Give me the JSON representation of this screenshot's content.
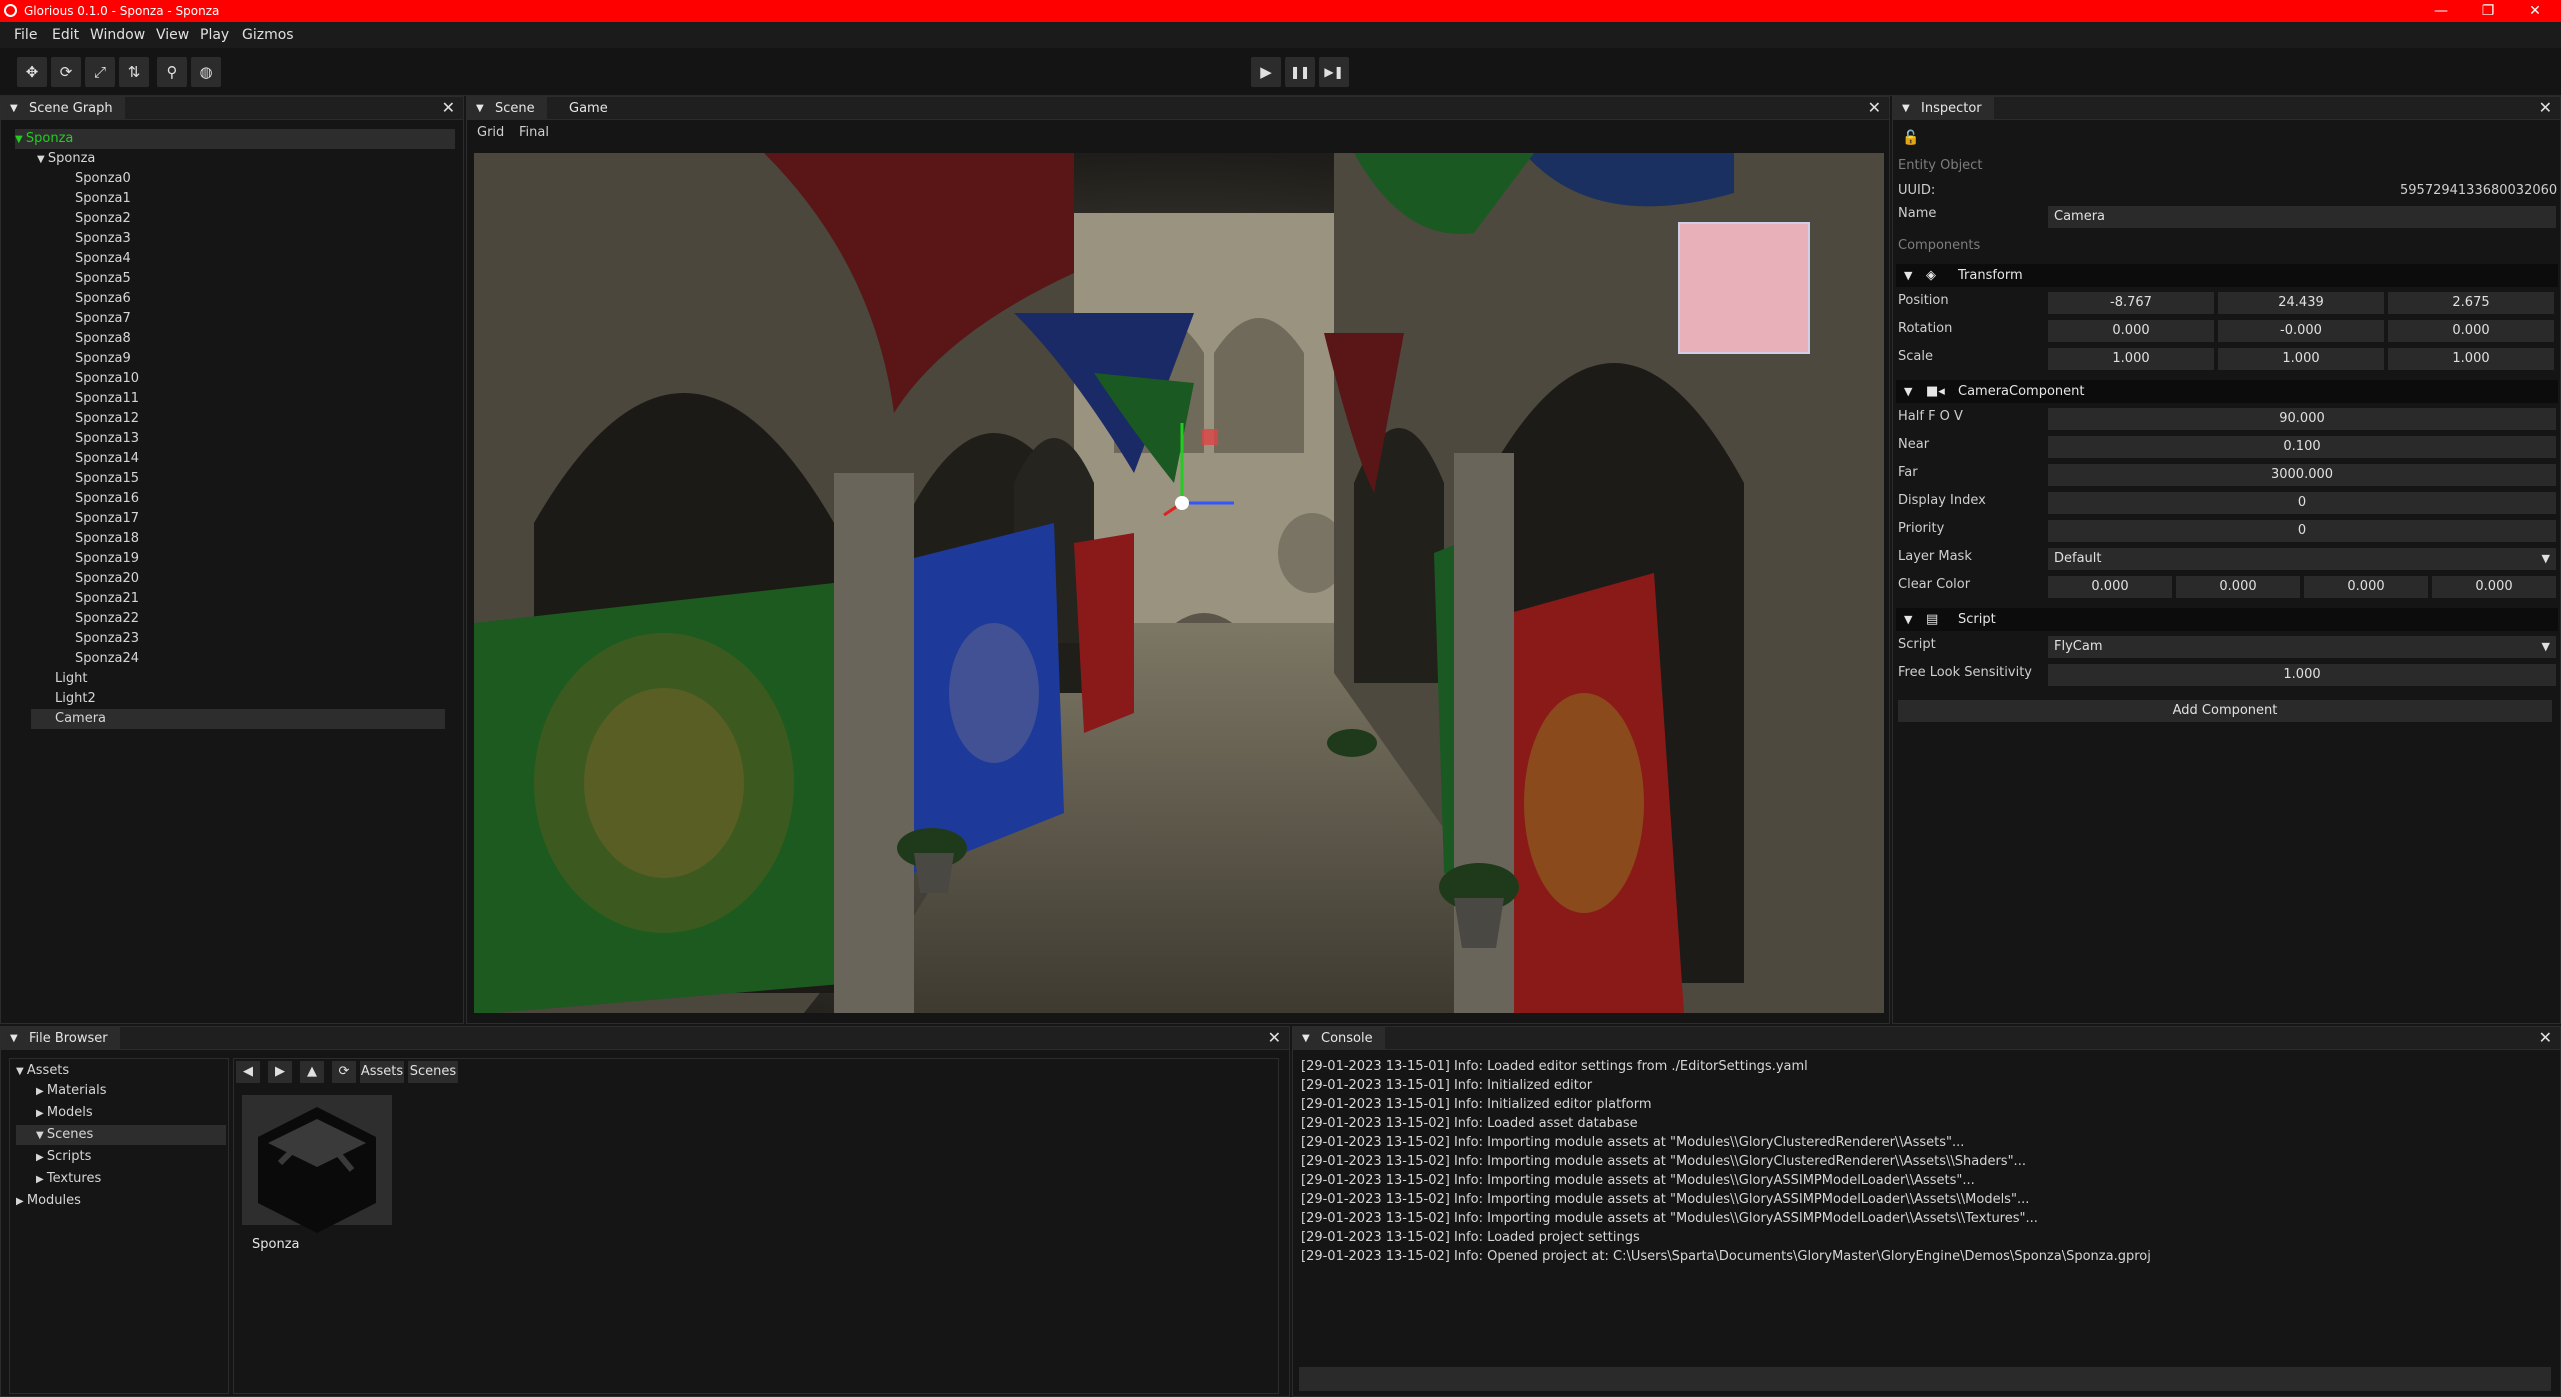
{
  "window": {
    "title": "Glorious 0.1.0 - Sponza - Sponza",
    "minimize": "—",
    "maximize": "❐",
    "close": "✕"
  },
  "menu": [
    "File",
    "Edit",
    "Window",
    "View",
    "Play",
    "Gizmos"
  ],
  "toolbar": {
    "tools": [
      "translate",
      "rotate",
      "scale",
      "universal",
      "pin",
      "world"
    ],
    "playback": [
      "play",
      "pause",
      "step"
    ]
  },
  "scene_graph": {
    "tab": "Scene Graph",
    "root": "Sponza",
    "parent": "Sponza",
    "children": [
      "Sponza0",
      "Sponza1",
      "Sponza2",
      "Sponza3",
      "Sponza4",
      "Sponza5",
      "Sponza6",
      "Sponza7",
      "Sponza8",
      "Sponza9",
      "Sponza10",
      "Sponza11",
      "Sponza12",
      "Sponza13",
      "Sponza14",
      "Sponza15",
      "Sponza16",
      "Sponza17",
      "Sponza18",
      "Sponza19",
      "Sponza20",
      "Sponza21",
      "Sponza22",
      "Sponza23",
      "Sponza24"
    ],
    "others": [
      "Light",
      "Light2",
      "Camera"
    ]
  },
  "scene_view": {
    "tabs": [
      "Scene",
      "Game"
    ],
    "subtabs": [
      "Grid",
      "Final"
    ]
  },
  "inspector": {
    "tab": "Inspector",
    "entity_object": "Entity Object",
    "uuid_label": "UUID:",
    "uuid": "5957294133680032060",
    "name_label": "Name",
    "name": "Camera",
    "components_label": "Components",
    "transform": {
      "title": "Transform",
      "position_label": "Position",
      "position": [
        "-8.767",
        "24.439",
        "2.675"
      ],
      "rotation_label": "Rotation",
      "rotation": [
        "0.000",
        "-0.000",
        "0.000"
      ],
      "scale_label": "Scale",
      "scale": [
        "1.000",
        "1.000",
        "1.000"
      ]
    },
    "camera": {
      "title": "CameraComponent",
      "half_fov_label": "Half F O V",
      "half_fov": "90.000",
      "near_label": "Near",
      "near": "0.100",
      "far_label": "Far",
      "far": "3000.000",
      "display_index_label": "Display Index",
      "display_index": "0",
      "priority_label": "Priority",
      "priority": "0",
      "layer_mask_label": "Layer Mask",
      "layer_mask": "Default",
      "clear_color_label": "Clear Color",
      "clear_color": [
        "0.000",
        "0.000",
        "0.000",
        "0.000"
      ]
    },
    "script": {
      "title": "Script",
      "script_label": "Script",
      "script": "FlyCam",
      "sensitivity_label": "Free Look Sensitivity",
      "sensitivity": "1.000"
    },
    "add_component": "Add Component"
  },
  "file_browser": {
    "tab": "File Browser",
    "tree": {
      "assets": "Assets",
      "materials": "Materials",
      "models": "Models",
      "scenes": "Scenes",
      "scripts": "Scripts",
      "textures": "Textures",
      "modules": "Modules"
    },
    "path": [
      "Assets",
      "Scenes"
    ],
    "items": [
      {
        "name": "Sponza"
      }
    ]
  },
  "console": {
    "tab": "Console",
    "lines": [
      "[29-01-2023 13-15-01] Info:   Loaded editor settings from ./EditorSettings.yaml",
      "[29-01-2023 13-15-01] Info:   Initialized editor",
      "[29-01-2023 13-15-01] Info:   Initialized editor platform",
      "[29-01-2023 13-15-02] Info:   Loaded asset database",
      "[29-01-2023 13-15-02] Info:   Importing module assets at \"Modules\\\\GloryClusteredRenderer\\\\Assets\"...",
      "[29-01-2023 13-15-02] Info:   Importing module assets at \"Modules\\\\GloryClusteredRenderer\\\\Assets\\\\Shaders\"...",
      "[29-01-2023 13-15-02] Info:   Importing module assets at \"Modules\\\\GloryASSIMPModelLoader\\\\Assets\"...",
      "[29-01-2023 13-15-02] Info:   Importing module assets at \"Modules\\\\GloryASSIMPModelLoader\\\\Assets\\\\Models\"...",
      "[29-01-2023 13-15-02] Info:   Importing module assets at \"Modules\\\\GloryASSIMPModelLoader\\\\Assets\\\\Textures\"...",
      "[29-01-2023 13-15-02] Info:   Loaded project settings",
      "[29-01-2023 13-15-02] Info:   Opened project at: C:\\Users\\Sparta\\Documents\\GloryMaster\\GloryEngine\\Demos\\Sponza\\Sponza.gproj"
    ]
  },
  "colors": {
    "titlebar": "#ff0000",
    "selected_root": "#22cc22"
  }
}
